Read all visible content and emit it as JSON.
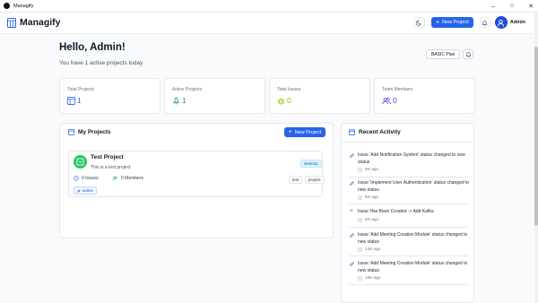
{
  "window": {
    "title": "Managify",
    "minimize": "–",
    "maximize": "□",
    "close": "✕"
  },
  "header": {
    "brand": "Managify",
    "new_project_label": "New Project",
    "user_name": "Admin"
  },
  "dashboard": {
    "greeting": "Hello, Admin!",
    "subtitle": "You have 1 active projects today",
    "plan": "BASIC Plan"
  },
  "stats": [
    {
      "label": "Total Projects",
      "value": "1",
      "color": "#2563eb",
      "icon": "projects-icon"
    },
    {
      "label": "Active Projects",
      "value": "1",
      "color": "#16a34a",
      "icon": "rocket-icon"
    },
    {
      "label": "Total Issues",
      "value": "0",
      "color": "#84cc16",
      "icon": "bug-icon"
    },
    {
      "label": "Team Members",
      "value": "0",
      "color": "#4f46e5",
      "icon": "users-icon"
    }
  ],
  "my_projects": {
    "title": "My Projects",
    "new_project_label": "New Project",
    "projects": [
      {
        "name": "Test Project",
        "description": "This is a test project",
        "platform": "desktop",
        "issues": "0 Issues",
        "members": "0 Members",
        "tags": [
          "test",
          "project"
        ],
        "status": "active"
      }
    ]
  },
  "recent_activity": {
    "title": "Recent Activity",
    "items": [
      {
        "text": "Issue 'Add Notification System' status changed to new status",
        "time": "9m ago",
        "icon": "edit-icon"
      },
      {
        "text": "Issue 'Implement User Authentication' status changed to new status",
        "time": "9m ago",
        "icon": "edit-icon"
      },
      {
        "text": "Issue Has Been Created -> Add Kafka",
        "time": "9m ago",
        "icon": "plus-icon"
      },
      {
        "text": "Issue 'Add Meeting Creation Module' status changed to new status",
        "time": "13m ago",
        "icon": "edit-icon"
      },
      {
        "text": "Issue 'Add Meeting Creation Module' status changed to new status",
        "time": "13m ago",
        "icon": "edit-icon"
      }
    ]
  },
  "colors": {
    "primary": "#2563eb",
    "success": "#16a34a",
    "muted": "#6b7280"
  }
}
